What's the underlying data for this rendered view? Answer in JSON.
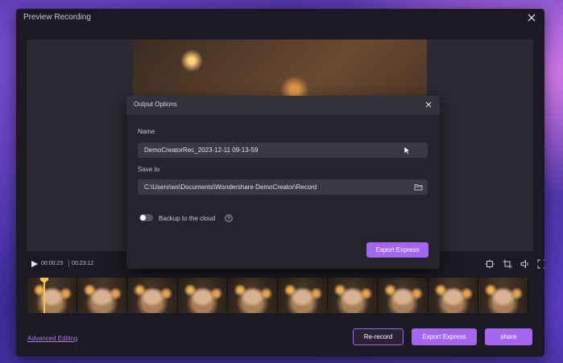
{
  "window": {
    "title": "Preview Recording",
    "close_icon": "close-icon"
  },
  "player": {
    "current_time": "00:00:23",
    "total_time": "00:23:12",
    "play_icon": "play-icon",
    "tools": [
      "fit-screen-icon",
      "crop-icon",
      "volume-icon",
      "fullscreen-icon"
    ]
  },
  "timeline": {
    "frame_count": 10
  },
  "footer": {
    "advanced_editing_label": "Advanced Editing",
    "rerecord_label": "Re-record",
    "export_express_label": "Export Express",
    "share_label": "share"
  },
  "dialog": {
    "title": "Output Options",
    "name_label": "Name",
    "name_value": "DemoCreatorRec_2023-12-11 09-13-59",
    "save_to_label": "Save to",
    "save_to_value": "C:\\Users\\ws\\Documents\\Wondershare DemoCreator\\Record",
    "backup_label": "Backup to the cloud",
    "backup_enabled": false,
    "export_button_label": "Export Express"
  },
  "colors": {
    "accent": "#a465ef",
    "window_bg": "#1b1a22",
    "dialog_bg": "#25242c",
    "link": "#a97fe3"
  }
}
